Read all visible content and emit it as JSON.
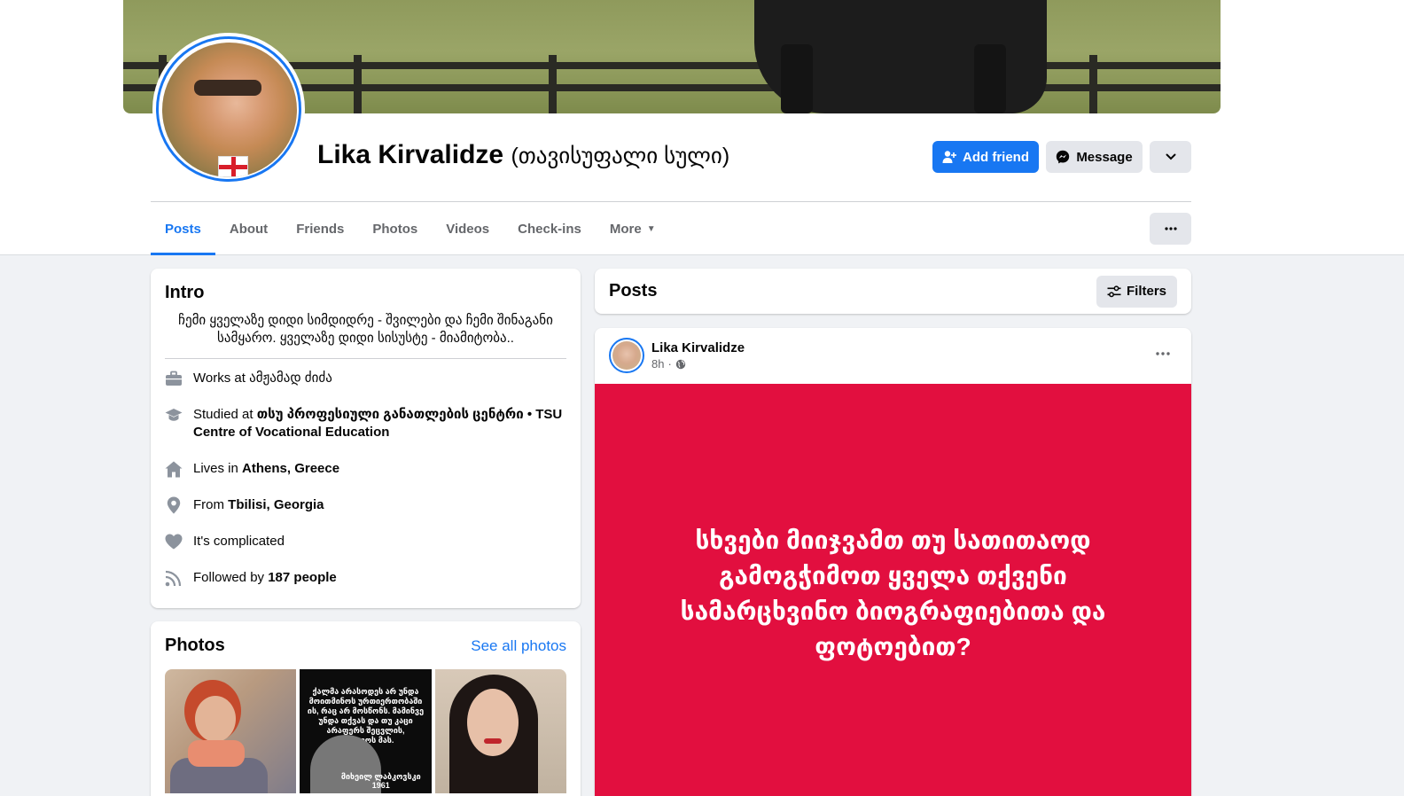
{
  "profile": {
    "name": "Lika Kirvalidze",
    "alt_name": "(თავისუფალი სული)"
  },
  "actions": {
    "add_friend": "Add friend",
    "message": "Message"
  },
  "tabs": [
    {
      "label": "Posts",
      "active": true
    },
    {
      "label": "About"
    },
    {
      "label": "Friends"
    },
    {
      "label": "Photos"
    },
    {
      "label": "Videos"
    },
    {
      "label": "Check-ins"
    },
    {
      "label": "More"
    }
  ],
  "intro": {
    "title": "Intro",
    "bio": "ჩემი ყველაზე დიდი სიმდიდრე - შვილები და ჩემი შინაგანი სამყარო. ყველაზე დიდი სისუსტე - მიამიტობა..",
    "work": {
      "prefix": "Works at ",
      "value": "ამჟამად ძიძა"
    },
    "study": {
      "prefix": "Studied at ",
      "value": "თსუ პროფესიული განათლების ცენტრი • TSU Centre of Vocational Education"
    },
    "lives": {
      "prefix": "Lives in ",
      "value": "Athens, Greece"
    },
    "from": {
      "prefix": "From ",
      "value": "Tbilisi, Georgia"
    },
    "relationship": "It's complicated",
    "followed": {
      "prefix": "Followed by ",
      "value": "187 people"
    }
  },
  "photos": {
    "title": "Photos",
    "see_all": "See all photos",
    "quote_text": "ქალმა არასოდეს არ უნდა მოითმინოს ურთიერთობაში ის, რაც არ მოსწონს. მამინვე უნდა თქვას და თუ კაცი არაფერს შეცვლის, დატოვოს მას.",
    "quote_author": "მიხეილ ლაბკოვსკი",
    "quote_year": "1961"
  },
  "posts_section": {
    "title": "Posts",
    "filters": "Filters"
  },
  "post": {
    "author": "Lika Kirvalidze",
    "time": "8h",
    "separator": "·",
    "text": "სხვები მიიჯვამთ თუ სათითაოდ გამოგჭიმოთ ყველა თქვენი სამარცხვინო ბიოგრაფიებითა და ფოტოებით?",
    "background_color": "#e20f3f"
  },
  "colors": {
    "accent": "#1877f2",
    "page_bg": "#f0f2f5"
  }
}
